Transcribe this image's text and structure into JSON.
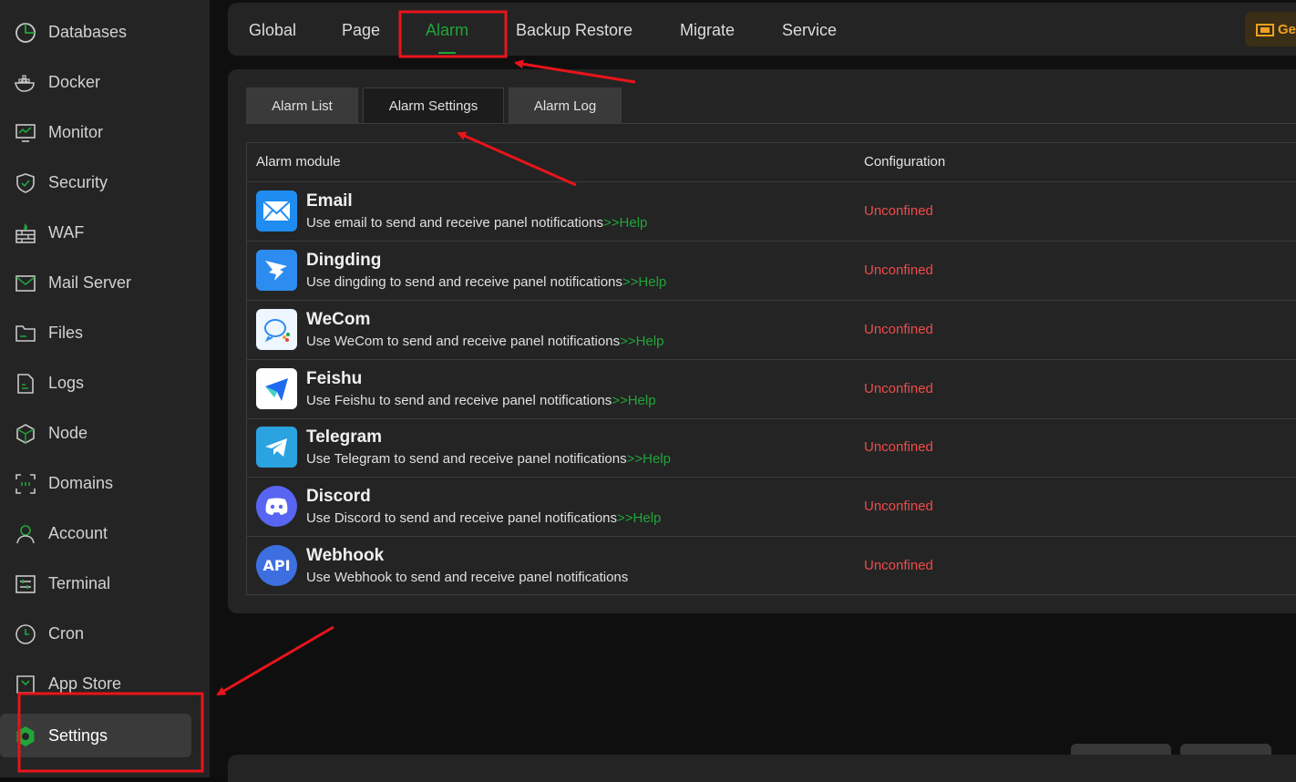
{
  "sidebar": {
    "items": [
      {
        "label": "Databases",
        "icon": "database-icon"
      },
      {
        "label": "Docker",
        "icon": "docker-icon"
      },
      {
        "label": "Monitor",
        "icon": "monitor-icon"
      },
      {
        "label": "Security",
        "icon": "shield-icon"
      },
      {
        "label": "WAF",
        "icon": "firewall-icon"
      },
      {
        "label": "Mail Server",
        "icon": "mail-icon"
      },
      {
        "label": "Files",
        "icon": "folder-icon"
      },
      {
        "label": "Logs",
        "icon": "log-file-icon"
      },
      {
        "label": "Node",
        "icon": "cube-icon"
      },
      {
        "label": "Domains",
        "icon": "domain-icon"
      },
      {
        "label": "Account",
        "icon": "user-icon"
      },
      {
        "label": "Terminal",
        "icon": "terminal-icon"
      },
      {
        "label": "Cron",
        "icon": "clock-icon"
      },
      {
        "label": "App Store",
        "icon": "store-icon"
      },
      {
        "label": "Settings",
        "icon": "settings-icon"
      }
    ],
    "active": "Settings"
  },
  "topbar": {
    "tabs": [
      "Global",
      "Page",
      "Alarm",
      "Backup Restore",
      "Migrate",
      "Service"
    ],
    "active": "Alarm",
    "right_button": "Ge"
  },
  "subtabs": {
    "items": [
      "Alarm List",
      "Alarm Settings",
      "Alarm Log"
    ],
    "active": "Alarm Settings"
  },
  "table": {
    "headers": [
      "Alarm module",
      "Configuration"
    ],
    "rows": [
      {
        "name": "Email",
        "desc": "Use email to send and receive panel notifications",
        "help": ">>Help",
        "status": "Unconfined"
      },
      {
        "name": "Dingding",
        "desc": "Use dingding to send and receive panel notifications",
        "help": ">>Help",
        "status": "Unconfined"
      },
      {
        "name": "WeCom",
        "desc": "Use WeCom to send and receive panel notifications",
        "help": ">>Help",
        "status": "Unconfined"
      },
      {
        "name": "Feishu",
        "desc": "Use Feishu to send and receive panel notifications",
        "help": ">>Help",
        "status": "Unconfined"
      },
      {
        "name": "Telegram",
        "desc": "Use Telegram to send and receive panel notifications",
        "help": ">>Help",
        "status": "Unconfined"
      },
      {
        "name": "Discord",
        "desc": "Use Discord to send and receive panel notifications",
        "help": ">>Help",
        "status": "Unconfined"
      },
      {
        "name": "Webhook",
        "desc": "Use Webhook to send and receive panel notifications",
        "help": "",
        "status": "Unconfined",
        "logo_text": "API"
      }
    ]
  },
  "colors": {
    "accent": "#20a53a",
    "status_error": "#ef4b4b",
    "annotation": "#e8141a"
  }
}
